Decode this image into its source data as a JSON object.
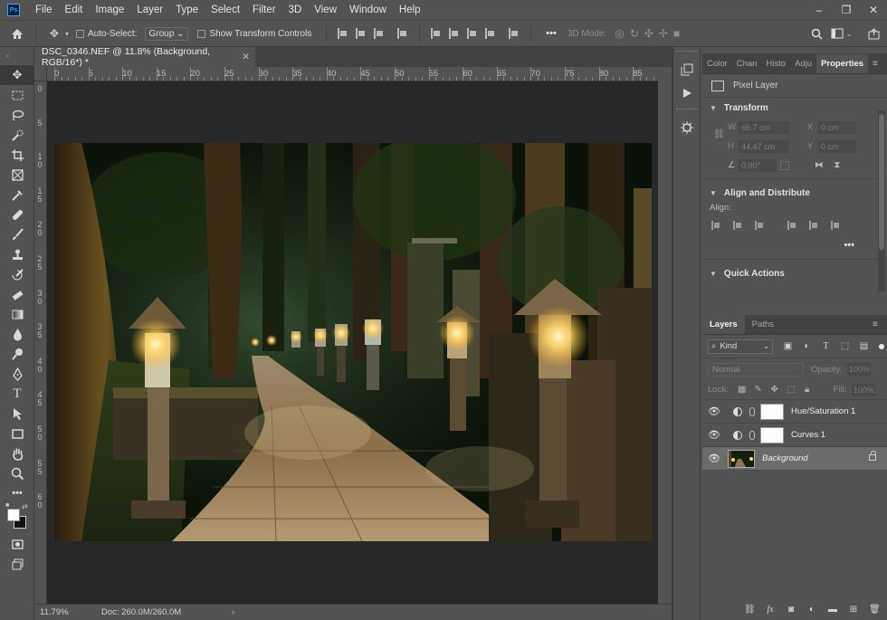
{
  "menu": [
    "File",
    "Edit",
    "Image",
    "Layer",
    "Type",
    "Select",
    "Filter",
    "3D",
    "View",
    "Window",
    "Help"
  ],
  "options_bar": {
    "auto_select_label": "Auto-Select:",
    "auto_select_value": "Group",
    "show_transform_label": "Show Transform Controls",
    "mode_label": "3D Mode:"
  },
  "document": {
    "tab_title": "DSC_0346.NEF @ 11.8% (Background, RGB/16*) *",
    "zoom": "11.79%",
    "doc_size": "Doc: 260.0M/260.0M"
  },
  "ruler": {
    "top": [
      "0",
      "5",
      "10",
      "15",
      "20",
      "25",
      "30",
      "35",
      "40",
      "45",
      "50",
      "55",
      "60",
      "65",
      "70",
      "75",
      "80",
      "85"
    ],
    "left": [
      "0",
      "5",
      "1\n0",
      "1\n5",
      "2\n0",
      "2\n5",
      "3\n0",
      "3\n5",
      "4\n0",
      "4\n5",
      "5\n0",
      "5\n5",
      "6\n0"
    ]
  },
  "properties_panel": {
    "tabs": [
      "Color",
      "Chan",
      "Histo",
      "Adju",
      "Properties"
    ],
    "active_tab": "Properties",
    "pixel_layer_label": "Pixel Layer",
    "transform_title": "Transform",
    "w_label": "W",
    "w_value": "66.7 cm",
    "x_label": "X",
    "x_value": "0 cm",
    "h_label": "H",
    "h_value": "44.47 cm",
    "y_label": "Y",
    "y_value": "0 cm",
    "angle_value": "0.00°",
    "align_title": "Align and Distribute",
    "align_label": "Align:",
    "quick_actions_title": "Quick Actions"
  },
  "layers_panel": {
    "tabs": [
      "Layers",
      "Paths"
    ],
    "kind_label": "Kind",
    "blend_mode": "Normal",
    "opacity_label": "Opacity:",
    "opacity_value": "100%",
    "lock_label": "Lock:",
    "fill_label": "Fill:",
    "fill_value": "100%",
    "layers": [
      {
        "name": "Hue/Saturation 1",
        "type": "adjustment"
      },
      {
        "name": "Curves 1",
        "type": "adjustment"
      },
      {
        "name": "Background",
        "type": "background",
        "selected": true,
        "locked": true
      }
    ]
  },
  "colors": {
    "ui_bg": "#535353",
    "canvas_bg": "#282828",
    "selected_layer": "#6b6b6b",
    "ps_blue": "#31a8ff"
  }
}
